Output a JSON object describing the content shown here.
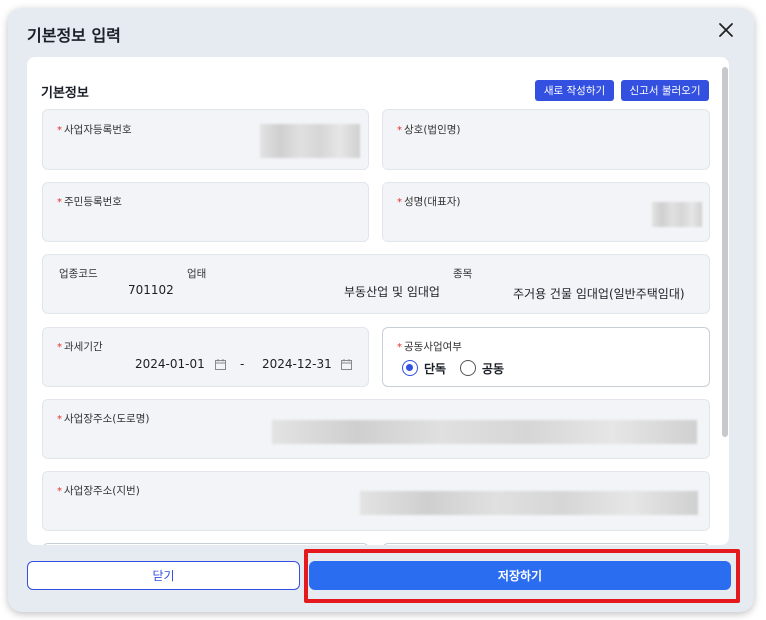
{
  "modal": {
    "title": "기본정보 입력",
    "close_icon": "close-icon"
  },
  "section": {
    "title": "기본정보",
    "new_button": "새로 작성하기",
    "load_button": "신고서 불러오기"
  },
  "fields": {
    "business_reg_no": {
      "label": "사업자등록번호",
      "required": "*"
    },
    "company_name": {
      "label": "상호(법인명)",
      "required": "*"
    },
    "resident_reg_no": {
      "label": "주민등록번호",
      "required": "*"
    },
    "representative": {
      "label": "성명(대표자)",
      "required": "*"
    },
    "industry": {
      "code_label": "업종코드",
      "code_value": "701102",
      "type_label": "업태",
      "type_value": "부동산업 및 임대업",
      "item_label": "종목",
      "item_value": "주거용 건물 임대업(일반주택임대)"
    },
    "tax_period": {
      "label": "과세기간",
      "required": "*",
      "start": "2024-01-01",
      "separator": "-",
      "end": "2024-12-31"
    },
    "joint_business": {
      "label": "공동사업여부",
      "required": "*",
      "options": [
        "단독",
        "공동"
      ],
      "selected": "단독"
    },
    "address_road": {
      "label": "사업장주소(도로명)",
      "required": "*"
    },
    "address_lot": {
      "label": "사업장주소(지번)",
      "required": "*"
    }
  },
  "footer": {
    "close_button": "닫기",
    "save_button": "저장하기"
  },
  "colors": {
    "primary": "#3350e0",
    "save": "#2b6df0",
    "highlight": "#e4191d",
    "required": "#e0312d"
  }
}
